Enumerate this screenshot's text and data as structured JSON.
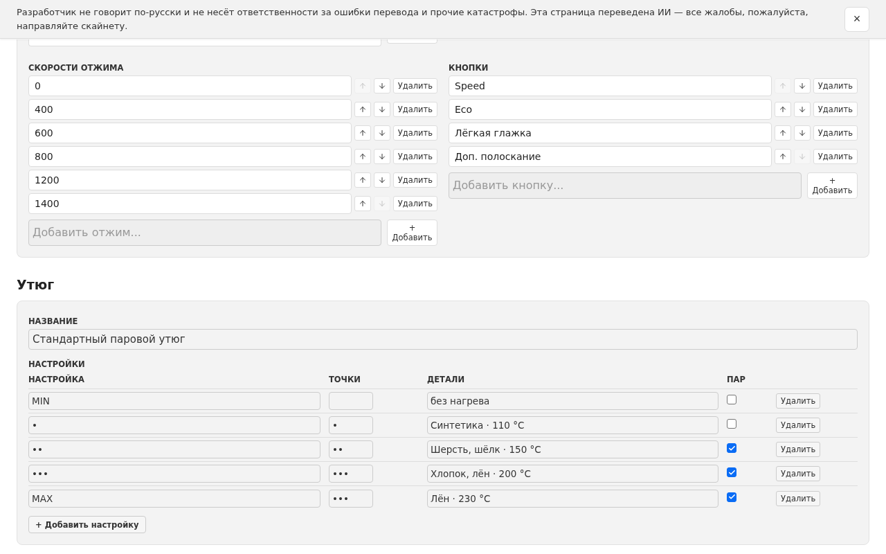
{
  "notice": {
    "text": "Разработчик не говорит по-русски и не несёт ответственности за ошибки перевода и прочие катастрофы. Эта страница переведена ИИ — все жалобы, пожалуйста, направляйте скайнету.",
    "close": "×"
  },
  "washer": {
    "spin": {
      "label": "СКОРОСТИ ОТЖИМА",
      "items": [
        {
          "value": "0",
          "up_disabled": true,
          "down_disabled": false,
          "delete": "Удалить"
        },
        {
          "value": "400",
          "up_disabled": false,
          "down_disabled": false,
          "delete": "Удалить"
        },
        {
          "value": "600",
          "up_disabled": false,
          "down_disabled": false,
          "delete": "Удалить"
        },
        {
          "value": "800",
          "up_disabled": false,
          "down_disabled": false,
          "delete": "Удалить"
        },
        {
          "value": "1200",
          "up_disabled": false,
          "down_disabled": false,
          "delete": "Удалить"
        },
        {
          "value": "1400",
          "up_disabled": false,
          "down_disabled": true,
          "delete": "Удалить"
        }
      ],
      "add_placeholder": "Добавить отжим...",
      "add_button": [
        "+",
        "Добавить"
      ]
    },
    "buttons": {
      "label": "КНОПКИ",
      "items": [
        {
          "value": "Speed",
          "up_disabled": true,
          "down_disabled": false,
          "delete": "Удалить"
        },
        {
          "value": "Eco",
          "up_disabled": false,
          "down_disabled": false,
          "delete": "Удалить"
        },
        {
          "value": "Лёгкая глажка",
          "up_disabled": false,
          "down_disabled": false,
          "delete": "Удалить"
        },
        {
          "value": "Доп. полоскание",
          "up_disabled": false,
          "down_disabled": true,
          "delete": "Удалить"
        }
      ],
      "add_placeholder": "Добавить кнопку...",
      "add_button": [
        "+",
        "Добавить"
      ]
    }
  },
  "iron": {
    "title": "Утюг",
    "name_label": "НАЗВАНИЕ",
    "name": "Стандартный паровой утюг",
    "settings_label": "НАСТРОЙКИ",
    "columns": [
      "НАСТРОЙКА",
      "ТОЧКИ",
      "ДЕТАЛИ",
      "ПАР"
    ],
    "rows": [
      {
        "setting": "MIN",
        "dots": "",
        "details": "без нагрева",
        "steam": false,
        "delete": "Удалить"
      },
      {
        "setting": "•",
        "dots": "•",
        "details": "Синтетика · 110 °C",
        "steam": false,
        "delete": "Удалить"
      },
      {
        "setting": "••",
        "dots": "••",
        "details": "Шерсть, шёлк · 150 °C",
        "steam": true,
        "delete": "Удалить"
      },
      {
        "setting": "•••",
        "dots": "•••",
        "details": "Хлопок, лён · 200 °C",
        "steam": true,
        "delete": "Удалить"
      },
      {
        "setting": "MAX",
        "dots": "•••",
        "details": "Лён · 230 °C",
        "steam": true,
        "delete": "Удалить"
      }
    ],
    "add_setting": "+ Добавить настройку"
  }
}
